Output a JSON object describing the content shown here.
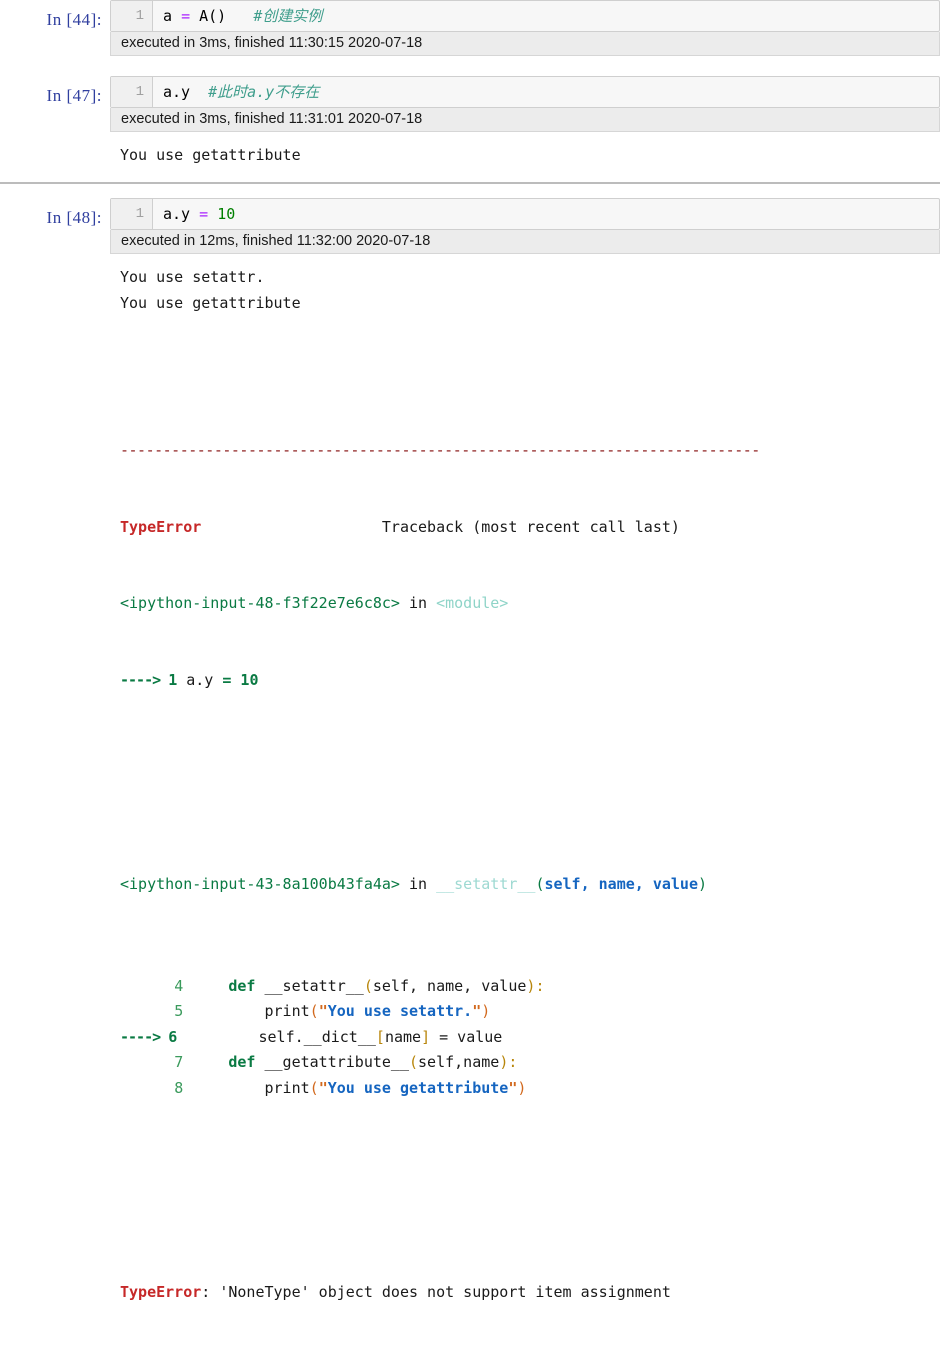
{
  "notebook": {
    "cells": [
      {
        "id": "cell-44",
        "prompt": "In  [44]:",
        "line_number": "1",
        "code_tokens": [
          {
            "text": "a ",
            "cls": "tok-plain"
          },
          {
            "text": "=",
            "cls": "tok-op"
          },
          {
            "text": " A()   ",
            "cls": "tok-plain"
          },
          {
            "text": "#创建实例",
            "cls": "tok-comment"
          }
        ],
        "exec_info": "executed in 3ms, finished 11:30:15 2020-07-18",
        "stdout": "",
        "separated": false
      },
      {
        "id": "cell-47",
        "prompt": "In  [47]:",
        "line_number": "1",
        "code_tokens": [
          {
            "text": "a.y  ",
            "cls": "tok-plain"
          },
          {
            "text": "#此时a.y不存在",
            "cls": "tok-comment"
          }
        ],
        "exec_info": "executed in 3ms, finished 11:31:01 2020-07-18",
        "stdout": "You use getattribute",
        "separated": false
      },
      {
        "id": "cell-48",
        "prompt": "In  [48]:",
        "line_number": "1",
        "code_tokens": [
          {
            "text": "a.y ",
            "cls": "tok-plain"
          },
          {
            "text": "=",
            "cls": "tok-op"
          },
          {
            "text": " ",
            "cls": "tok-plain"
          },
          {
            "text": "10",
            "cls": "tok-num"
          }
        ],
        "exec_info": "executed in 12ms, finished 11:32:00 2020-07-18",
        "stdout": "You use setattr.\nYou use getattribute",
        "separated": true
      }
    ],
    "traceback": {
      "rule": "---------------------------------------------------------------------------",
      "header_error": "TypeError",
      "header_trace": "Traceback (most recent call last)",
      "frame1_file": "<ipython-input-48-f3f22e7e6c8c>",
      "frame1_in": " in ",
      "frame1_scope": "<module>",
      "frame1_arrow": "----> ",
      "frame1_lineno": "1",
      "frame1_code_plain": " a.y ",
      "frame1_code_op": "=",
      "frame1_code_num": " 10",
      "frame2_file": "<ipython-input-43-8a100b43fa4a>",
      "frame2_in": " in ",
      "frame2_dunder": "__setattr__",
      "frame2_lparen": "(",
      "frame2_args": "self, name, value",
      "frame2_rparen": ")",
      "code_lines": [
        {
          "arrow": "      ",
          "lineno": "4",
          "highlighted": false,
          "tokens": [
            {
              "text": "     ",
              "cls": "tb-plain"
            },
            {
              "text": "def",
              "cls": "tb-kw"
            },
            {
              "text": " __setattr__",
              "cls": "tb-fname"
            },
            {
              "text": "(",
              "cls": "tb-sigparen"
            },
            {
              "text": "self, name, value",
              "cls": "tb-sigargs"
            },
            {
              "text": ")",
              "cls": "tb-sigparen"
            },
            {
              "text": ":",
              "cls": "tb-sigparen"
            }
          ]
        },
        {
          "arrow": "      ",
          "lineno": "5",
          "highlighted": false,
          "tokens": [
            {
              "text": "         print",
              "cls": "tb-plain"
            },
            {
              "text": "(",
              "cls": "tb-callparen"
            },
            {
              "text": "\"",
              "cls": "tb-quote"
            },
            {
              "text": "You use setattr.",
              "cls": "tb-str"
            },
            {
              "text": "\"",
              "cls": "tb-quote"
            },
            {
              "text": ")",
              "cls": "tb-callparen"
            }
          ]
        },
        {
          "arrow": "----> ",
          "lineno": "6",
          "highlighted": true,
          "tokens": [
            {
              "text": "         self.__dict__",
              "cls": "tb-plain"
            },
            {
              "text": "[",
              "cls": "tb-bracket"
            },
            {
              "text": "name",
              "cls": "tb-plain"
            },
            {
              "text": "]",
              "cls": "tb-bracket"
            },
            {
              "text": " = value",
              "cls": "tb-plain"
            }
          ]
        },
        {
          "arrow": "      ",
          "lineno": "7",
          "highlighted": false,
          "tokens": [
            {
              "text": "     ",
              "cls": "tb-plain"
            },
            {
              "text": "def",
              "cls": "tb-kw"
            },
            {
              "text": " __getattribute__",
              "cls": "tb-fname"
            },
            {
              "text": "(",
              "cls": "tb-sigparen"
            },
            {
              "text": "self,name",
              "cls": "tb-sigargs"
            },
            {
              "text": ")",
              "cls": "tb-sigparen"
            },
            {
              "text": ":",
              "cls": "tb-sigparen"
            }
          ]
        },
        {
          "arrow": "      ",
          "lineno": "8",
          "highlighted": false,
          "tokens": [
            {
              "text": "         print",
              "cls": "tb-plain"
            },
            {
              "text": "(",
              "cls": "tb-callparen"
            },
            {
              "text": "\"",
              "cls": "tb-quote"
            },
            {
              "text": "You use getattribute",
              "cls": "tb-str"
            },
            {
              "text": "\"",
              "cls": "tb-quote"
            },
            {
              "text": ")",
              "cls": "tb-callparen"
            }
          ]
        }
      ],
      "final_error_name": "TypeError",
      "final_error_msg": ": 'NoneType' object does not support item assignment"
    }
  },
  "colors": {
    "prompt": "#303f9f",
    "error": "#c62828",
    "string": "#1565c0",
    "comment": "#3f9e8c",
    "number": "#008000",
    "operator": "#aa22ff",
    "cell_bg": "#f7f7f7",
    "exec_bar_bg": "#ececec"
  }
}
